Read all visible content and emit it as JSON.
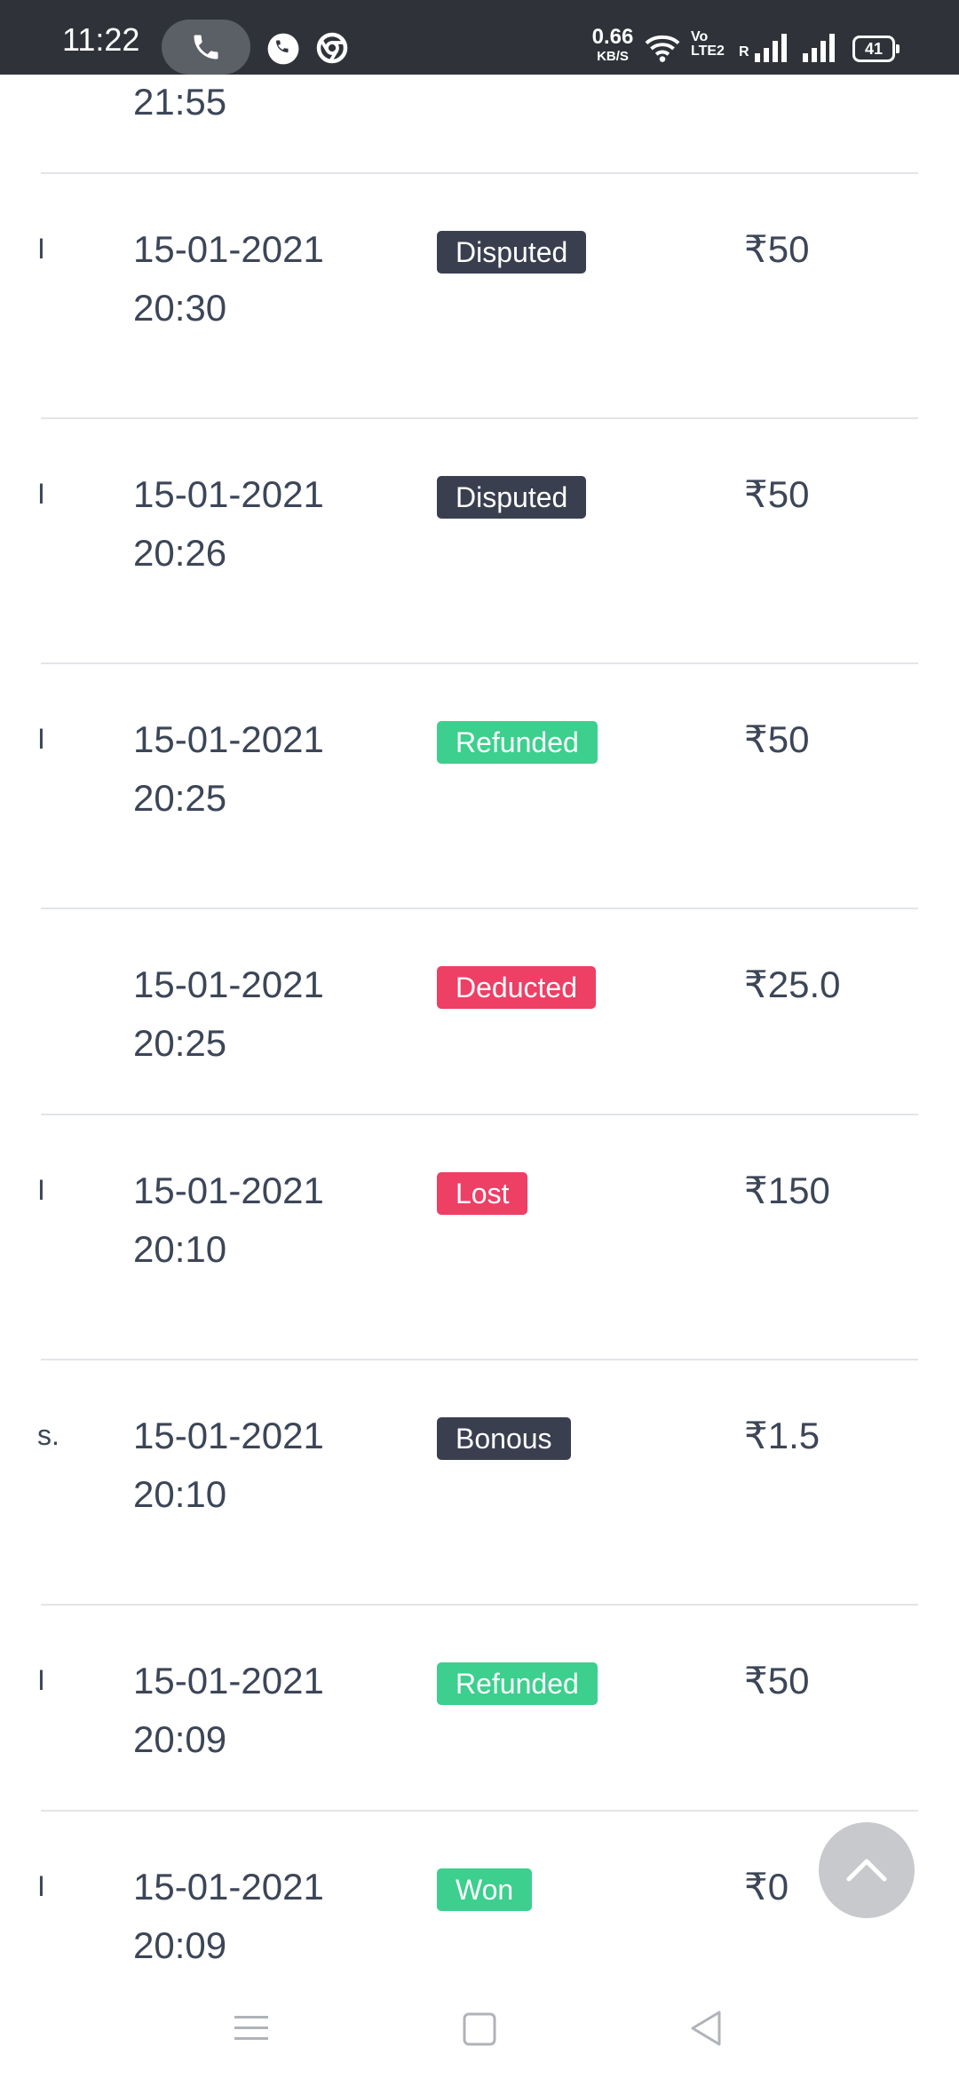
{
  "status_bar": {
    "time": "11:22",
    "net_speed_value": "0.66",
    "net_speed_unit": "KB/S",
    "volte": "Vo\nLTE2",
    "roaming": "R",
    "battery": "41"
  },
  "transactions": {
    "partial_top_time": "21:55",
    "rows": [
      {
        "edge": "I",
        "date": "15-01-2021",
        "time": "20:30",
        "status": "Disputed",
        "status_color": "#3a3f4f",
        "amount": "₹50"
      },
      {
        "edge": "I",
        "date": "15-01-2021",
        "time": "20:26",
        "status": "Disputed",
        "status_color": "#3a3f4f",
        "amount": "₹50"
      },
      {
        "edge": "I",
        "date": "15-01-2021",
        "time": "20:25",
        "status": "Refunded",
        "status_color": "#3ccf8d",
        "amount": "₹50"
      },
      {
        "edge": "",
        "date": "15-01-2021",
        "time": "20:25",
        "status": "Deducted",
        "status_color": "#ee3f65",
        "amount": "₹25.0"
      },
      {
        "edge": "I",
        "date": "15-01-2021",
        "time": "20:10",
        "status": "Lost",
        "status_color": "#ee3f65",
        "amount": "₹150"
      },
      {
        "edge": "s.",
        "date": "15-01-2021",
        "time": "20:10",
        "status": "Bonous",
        "status_color": "#3a3f4f",
        "amount": "₹1.5"
      },
      {
        "edge": "I",
        "date": "15-01-2021",
        "time": "20:09",
        "status": "Refunded",
        "status_color": "#3ccf8d",
        "amount": "₹50"
      },
      {
        "edge": "I",
        "date": "15-01-2021",
        "time": "20:09",
        "status": "Won",
        "status_color": "#3ccf8d",
        "amount": "₹0"
      }
    ]
  },
  "scroll_top_button": {
    "icon": "chevron-up-icon"
  },
  "nav_bar": {
    "icons": [
      "menu-icon",
      "home-square-icon",
      "back-triangle-icon"
    ]
  }
}
